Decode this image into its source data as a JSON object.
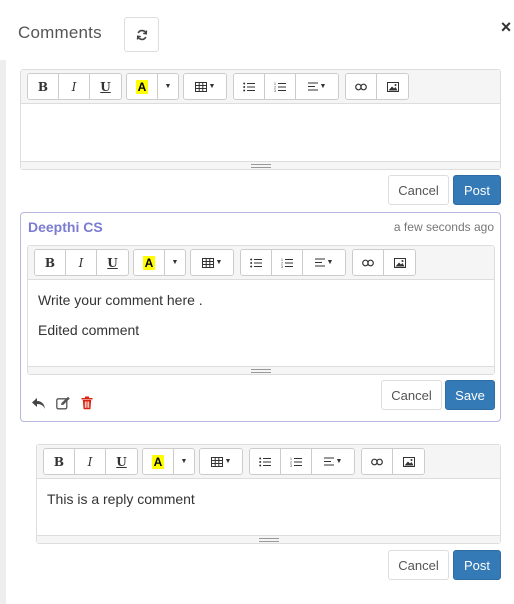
{
  "header": {
    "title": "Comments",
    "refresh_icon": "refresh-icon",
    "close_label": "×"
  },
  "toolbar": {
    "bold": "B",
    "italic": "I",
    "underline": "U",
    "highlight": "A",
    "highlight_color": "#ffff00",
    "icons": [
      "table-icon",
      "unordered-list-icon",
      "ordered-list-icon",
      "align-icon",
      "link-icon",
      "image-icon"
    ]
  },
  "new_comment": {
    "text": "",
    "cancel_label": "Cancel",
    "post_label": "Post"
  },
  "comment": {
    "author": "Deepthi CS",
    "timestamp": "a few seconds ago",
    "lines": [
      "Write your comment here .",
      "Edited comment"
    ],
    "cancel_label": "Cancel",
    "save_label": "Save",
    "actions": [
      "reply-icon",
      "edit-icon",
      "delete-icon"
    ]
  },
  "reply": {
    "text": "This is a reply comment",
    "cancel_label": "Cancel",
    "post_label": "Post"
  },
  "colors": {
    "primary": "#337ab7",
    "author": "#7b7bd1",
    "delete": "#d9230f"
  }
}
